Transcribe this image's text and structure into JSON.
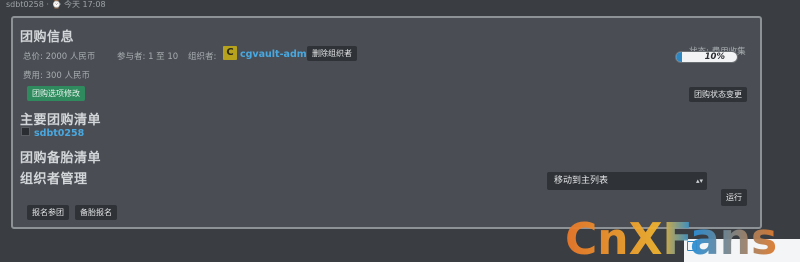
{
  "topbar": {
    "text": "sdbt0258 · ⌚ 今天 17:08"
  },
  "group_info": {
    "title": "团购信息",
    "total_price": "总价: 2000 人民币",
    "participants": "参与者: 1 至 10",
    "organizer_label": "组织者:",
    "organizer_avatar": "C",
    "organizer_name": "cgvault-admin",
    "remove_organizer_btn": "删除组织者",
    "fee": "费用: 300 人民币",
    "edit_options_btn": "团购选项修改",
    "status": "状态: 费用收集",
    "progress_percent": 10,
    "progress_text": "10%",
    "change_status_btn": "团购状态变更"
  },
  "main_list": {
    "title": "主要团购清单",
    "members": [
      "sdbt0258"
    ]
  },
  "backup_list": {
    "title": "团购备胎清单"
  },
  "organizer_mgmt": {
    "title": "组织者管理"
  },
  "actions": {
    "join_btn": "报名参团",
    "backup_btn": "备胎报名",
    "move_select_value": "移动到主列表",
    "run_btn": "运行"
  },
  "watermark": {
    "text": "CnXFans"
  },
  "colors": {
    "panel_bg": "#4a4e54",
    "page_bg": "#3a3e43",
    "link": "#49a8e0",
    "green_button": "#2f8a5e",
    "progress": "#2e86c1"
  }
}
